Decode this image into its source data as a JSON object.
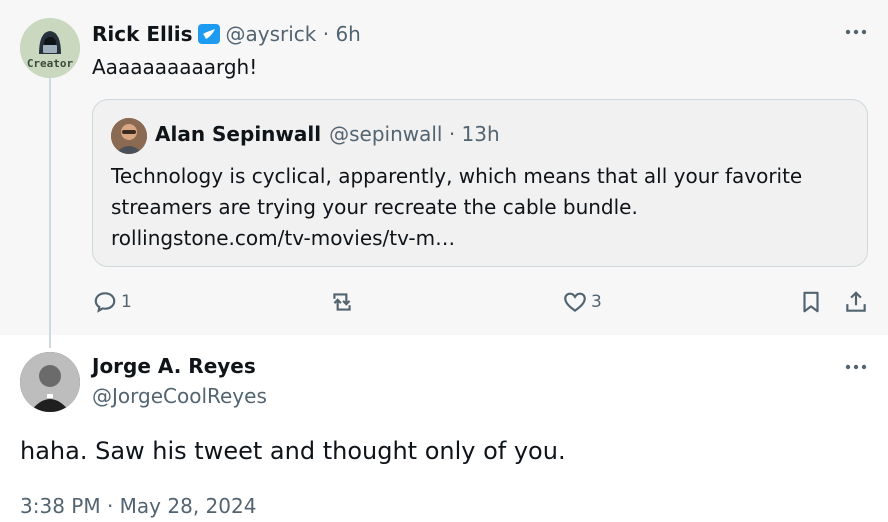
{
  "parent": {
    "name": "Rick Ellis",
    "handle_line": "@aysrick · 6h",
    "text": "Aaaaaaaaaargh!",
    "avatar_label": "Creator",
    "quote": {
      "name": "Alan Sepinwall",
      "handle_line": "@sepinwall · 13h",
      "lines": [
        "Technology is cyclical, apparently, which means that all your favorite",
        "streamers are trying your recreate the cable bundle.",
        "rollingstone.com/tv-movies/tv-m…"
      ]
    },
    "actions": {
      "reply_count": "1",
      "like_count": "3"
    }
  },
  "reply": {
    "name": "Jorge A. Reyes",
    "handle": "@JorgeCoolReyes",
    "text": "haha. Saw his tweet and thought only of you.",
    "timestamp": "3:38 PM · May 28, 2024"
  },
  "colors": {
    "verified": "#1d9bf0",
    "secondary_text": "#536471",
    "parent_background": "#f7f7f7"
  }
}
